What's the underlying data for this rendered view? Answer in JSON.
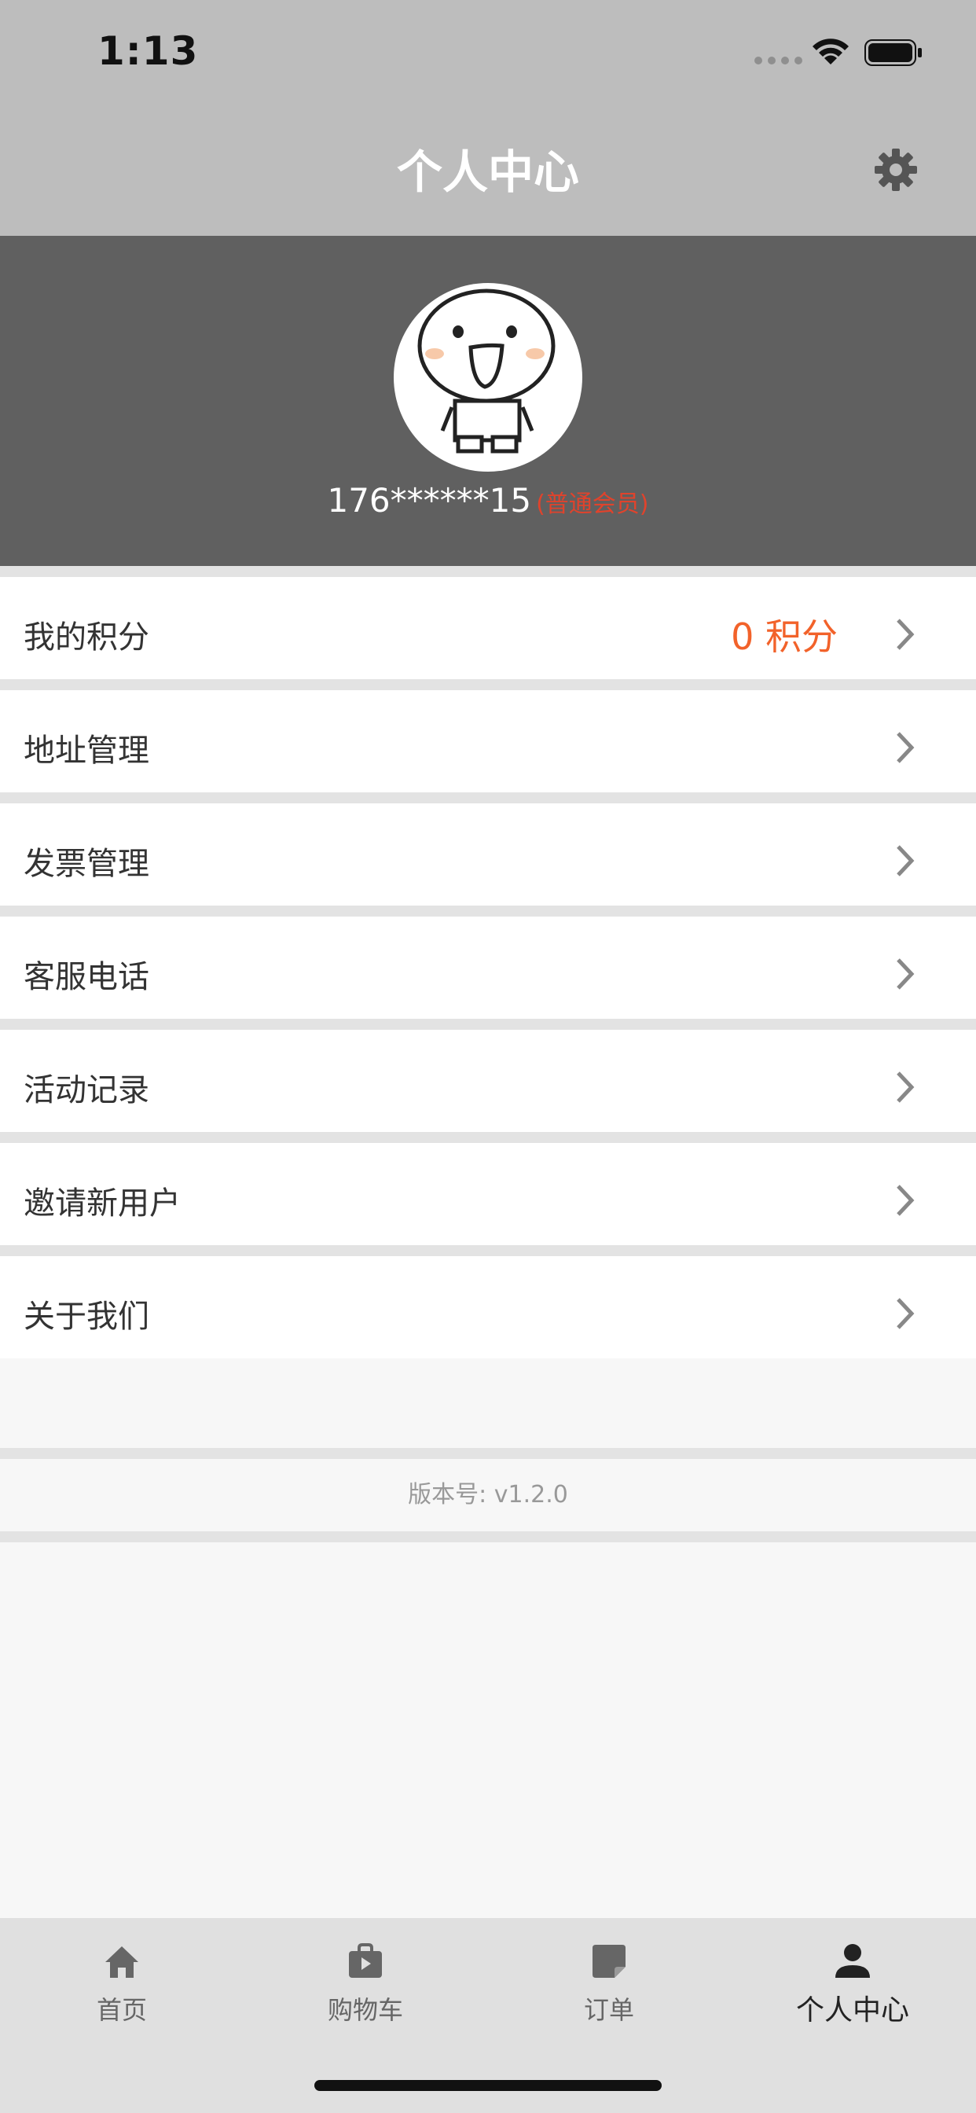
{
  "status_bar": {
    "time": "1:13"
  },
  "nav": {
    "title": "个人中心"
  },
  "profile": {
    "username": "176******15",
    "membership": "(普通会员)"
  },
  "menu": [
    {
      "label": "我的积分",
      "value": "0 积分"
    },
    {
      "label": "地址管理"
    },
    {
      "label": "发票管理"
    },
    {
      "label": "客服电话"
    },
    {
      "label": "活动记录"
    },
    {
      "label": "邀请新用户"
    },
    {
      "label": "关于我们"
    }
  ],
  "version": {
    "text": "版本号: v1.2.0"
  },
  "tabs": [
    {
      "label": "首页",
      "icon": "home-icon"
    },
    {
      "label": "购物车",
      "icon": "shopping-bag-icon"
    },
    {
      "label": "订单",
      "icon": "order-icon"
    },
    {
      "label": "个人中心",
      "icon": "person-icon",
      "active": true
    }
  ],
  "colors": {
    "accent": "#f2622a",
    "member": "#e0432c",
    "header": "#606060",
    "nav": "#bdbdbd"
  }
}
